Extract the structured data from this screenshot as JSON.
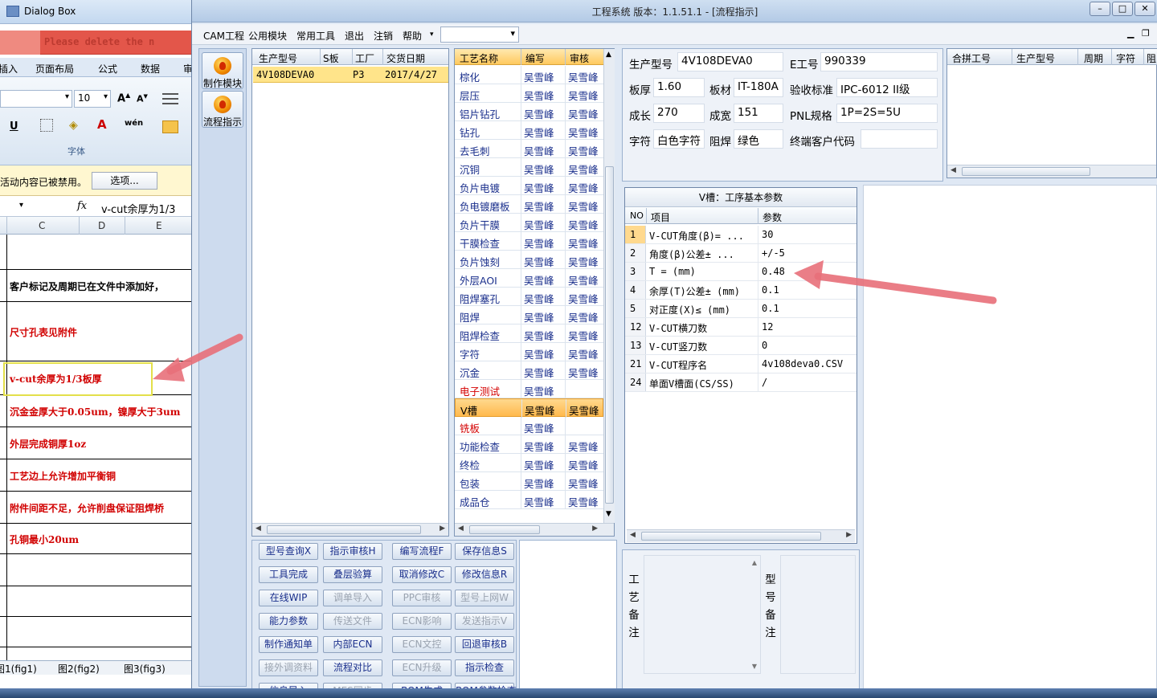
{
  "excel": {
    "title": "Dialog Box",
    "qa_text": "Please delete the n",
    "ribbon_tabs": [
      "插入",
      "页面布局",
      "公式",
      "数据",
      "审"
    ],
    "font_size": "10",
    "font_group": "字体",
    "msg": "活动内容已被禁用。",
    "msg_button": "选项...",
    "formula_value": "v-cut余厚为1/3",
    "columns": [
      "C",
      "D",
      "E"
    ],
    "rows": [
      {
        "text": "",
        "red": false
      },
      {
        "text": "客户标记及周期已在文件中添加好，",
        "red": false
      },
      {
        "text": "尺寸孔表见附件",
        "red": true
      },
      {
        "text": "v-cut余厚为1/3板厚",
        "red": true
      },
      {
        "text": "沉金金厚大于0.05um，镍厚大于3um",
        "red": true
      },
      {
        "text": "外层完成铜厚1oz",
        "red": true
      },
      {
        "text": "工艺边上允许增加平衡铜",
        "red": true
      },
      {
        "text": "附件间距不足，允许削盘保证阻焊桥",
        "red": true
      },
      {
        "text": "孔铜最小20um",
        "red": true
      },
      {
        "text": "",
        "red": false
      },
      {
        "text": "",
        "red": false
      },
      {
        "text": "",
        "red": false
      }
    ],
    "sheets": [
      "图1(fig1)",
      "图2(fig2)",
      "图3(fig3)"
    ]
  },
  "window": {
    "title": "工程系统   版本：1.1.51.1 - [流程指示]",
    "menu": [
      "CAM工程",
      "公用模块",
      "常用工具",
      "退出",
      "注销",
      "帮助"
    ]
  },
  "tools": [
    {
      "label": "制作模块"
    },
    {
      "label": "流程指示"
    }
  ],
  "product_grid": {
    "headers": [
      "生产型号",
      "S板",
      "工厂",
      "交货日期"
    ],
    "row": {
      "model": "4V108DEVA0",
      "s": "",
      "factory": "P3",
      "date": "2017/4/27"
    }
  },
  "process_grid": {
    "headers": [
      "工艺名称",
      "编写",
      "审核"
    ],
    "rows": [
      {
        "name": "棕化",
        "writer": "吴雪峰",
        "reviewer": "吴雪峰",
        "red": false
      },
      {
        "name": "层压",
        "writer": "吴雪峰",
        "reviewer": "吴雪峰",
        "red": false
      },
      {
        "name": "铝片钻孔",
        "writer": "吴雪峰",
        "reviewer": "吴雪峰",
        "red": false
      },
      {
        "name": "钻孔",
        "writer": "吴雪峰",
        "reviewer": "吴雪峰",
        "red": false
      },
      {
        "name": "去毛刺",
        "writer": "吴雪峰",
        "reviewer": "吴雪峰",
        "red": false
      },
      {
        "name": "沉铜",
        "writer": "吴雪峰",
        "reviewer": "吴雪峰",
        "red": false
      },
      {
        "name": "负片电镀",
        "writer": "吴雪峰",
        "reviewer": "吴雪峰",
        "red": false
      },
      {
        "name": "负电镀磨板",
        "writer": "吴雪峰",
        "reviewer": "吴雪峰",
        "red": false
      },
      {
        "name": "负片干膜",
        "writer": "吴雪峰",
        "reviewer": "吴雪峰",
        "red": false
      },
      {
        "name": "干膜检查",
        "writer": "吴雪峰",
        "reviewer": "吴雪峰",
        "red": false
      },
      {
        "name": "负片蚀刻",
        "writer": "吴雪峰",
        "reviewer": "吴雪峰",
        "red": false
      },
      {
        "name": "外层AOI",
        "writer": "吴雪峰",
        "reviewer": "吴雪峰",
        "red": false
      },
      {
        "name": "阻焊塞孔",
        "writer": "吴雪峰",
        "reviewer": "吴雪峰",
        "red": false
      },
      {
        "name": "阻焊",
        "writer": "吴雪峰",
        "reviewer": "吴雪峰",
        "red": false
      },
      {
        "name": "阻焊检查",
        "writer": "吴雪峰",
        "reviewer": "吴雪峰",
        "red": false
      },
      {
        "name": "字符",
        "writer": "吴雪峰",
        "reviewer": "吴雪峰",
        "red": false
      },
      {
        "name": "沉金",
        "writer": "吴雪峰",
        "reviewer": "吴雪峰",
        "red": false
      },
      {
        "name": "电子测试",
        "writer": "吴雪峰",
        "reviewer": "",
        "red": true
      },
      {
        "name": "V槽",
        "writer": "吴雪峰",
        "reviewer": "吴雪峰",
        "red": false,
        "selected": true
      },
      {
        "name": "铣板",
        "writer": "吴雪峰",
        "reviewer": "",
        "red": true
      },
      {
        "name": "功能检查",
        "writer": "吴雪峰",
        "reviewer": "吴雪峰",
        "red": false
      },
      {
        "name": "终检",
        "writer": "吴雪峰",
        "reviewer": "吴雪峰",
        "red": false
      },
      {
        "name": "包装",
        "writer": "吴雪峰",
        "reviewer": "吴雪峰",
        "red": false
      },
      {
        "name": "成品仓",
        "writer": "吴雪峰",
        "reviewer": "吴雪峰",
        "red": false
      }
    ]
  },
  "buttons": [
    [
      "型号查询X",
      "指示审核H",
      "编写流程F",
      "保存信息S"
    ],
    [
      "工具完成",
      "叠层验算",
      "取消修改C",
      "修改信息R"
    ],
    [
      "在线WIP",
      "调单导入",
      "PPC审核",
      "型号上网W"
    ],
    [
      "能力参数",
      "传送文件",
      "ECN影响",
      "发送指示V"
    ],
    [
      "制作通知单",
      "内部ECN",
      "ECN文控",
      "回退审核B"
    ],
    [
      "接外调资料",
      "流程对比",
      "ECN升级",
      "指示检查"
    ],
    [
      "信息导入",
      "MES同步",
      "BOM生成",
      "BOM参数检查"
    ]
  ],
  "disabled_buttons": [
    "调单导入",
    "PPC审核",
    "型号上网W",
    "传送文件",
    "ECN影响",
    "发送指示V",
    "ECN文控",
    "接外调资料",
    "ECN升级",
    "MES同步"
  ],
  "info": {
    "model_label": "生产型号",
    "model": "4V108DEVA0",
    "eno_label": "E工号",
    "eno": "990339",
    "thick_label": "板厚",
    "thick": "1.60",
    "mat_label": "板材",
    "mat": "IT-180A",
    "std_label": "验收标准",
    "std": "IPC-6012 II级",
    "len_label": "成长",
    "len": "270",
    "wid_label": "成宽",
    "wid": "151",
    "pnl_label": "PNL规格",
    "pnl": "1P=2S=5U",
    "char_label": "字符",
    "char": "白色字符",
    "mask_label": "阻焊",
    "mask": "绿色",
    "cust_label": "终端客户代码",
    "cust": ""
  },
  "merge_grid": {
    "headers": [
      "合拼工号",
      "生产型号",
      "周期",
      "字符",
      "阻"
    ]
  },
  "vgroove": {
    "title": "V槽：工序基本参数",
    "headers": [
      "NO",
      "项目",
      "参数"
    ],
    "rows": [
      {
        "no": "1",
        "item": "V-CUT角度(β)=  ...",
        "value": "30"
      },
      {
        "no": "2",
        "item": "角度(β)公差±  ...",
        "value": "+/-5"
      },
      {
        "no": "3",
        "item": "T =  (mm)",
        "value": "0.48"
      },
      {
        "no": "4",
        "item": "余厚(T)公差±  (mm)",
        "value": "0.1"
      },
      {
        "no": "5",
        "item": "对正度(X)≤ (mm)",
        "value": "0.1"
      },
      {
        "no": "12",
        "item": "V-CUT横刀数",
        "value": "12"
      },
      {
        "no": "13",
        "item": "V-CUT竖刀数",
        "value": "0"
      },
      {
        "no": "21",
        "item": "V-CUT程序名",
        "value": "4v108deva0.CSV"
      },
      {
        "no": "24",
        "item": "单面V槽面(CS/SS)",
        "value": "/"
      }
    ]
  },
  "notes": {
    "process_label": "工艺备注",
    "model_label": "型号备注"
  },
  "colors": {
    "accent": "#ffb94d",
    "red_text": "#d40000",
    "link_text": "#1a2f8c",
    "arrow": "#e8707a"
  }
}
